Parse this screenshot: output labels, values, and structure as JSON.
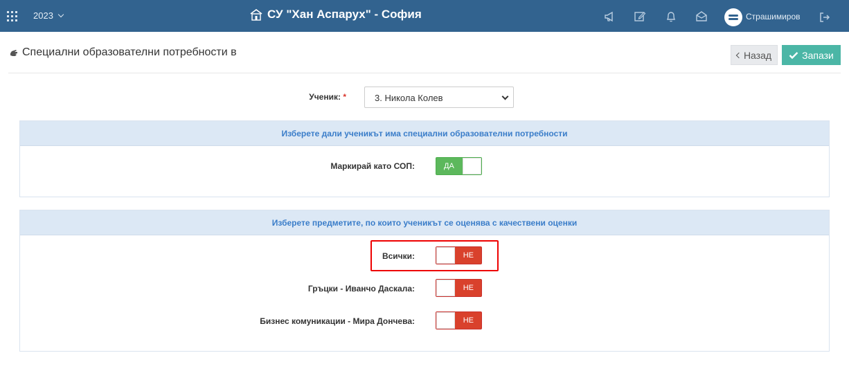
{
  "topbar": {
    "year": "2023",
    "school_name": "СУ \"Хан Аспарух\" - София",
    "username": "Страшимиров",
    "icons": [
      "apps-grid-icon",
      "megaphone-icon",
      "edit-icon",
      "bell-icon",
      "envelope-icon",
      "logout-icon"
    ]
  },
  "header": {
    "title": "Специални образователни потребности в",
    "back_label": "Назад",
    "save_label": "Запази"
  },
  "student": {
    "label": "Ученик:",
    "required_mark": "*",
    "selected": "3. Никола Колев"
  },
  "sop_panel": {
    "title": "Изберете дали ученикът има специални образователни потребности",
    "mark_label": "Маркирай като СОП:",
    "mark_state": "ДА"
  },
  "subjects_panel": {
    "title": "Изберете предметите, по които ученикът се оценява с качествени оценки",
    "rows": [
      {
        "label": "Всички:",
        "state": "НЕ"
      },
      {
        "label": "Гръцки - Иванчо Даскала:",
        "state": "НЕ"
      },
      {
        "label": "Бизнес комуникации - Мира Дончева:",
        "state": "НЕ"
      }
    ]
  },
  "colors": {
    "topbar": "#32638f",
    "panel_head": "#dce8f5",
    "panel_title": "#3a7dc9",
    "toggle_on": "#5cb85c",
    "toggle_off": "#d9412c",
    "save_button": "#4bb6a6"
  }
}
